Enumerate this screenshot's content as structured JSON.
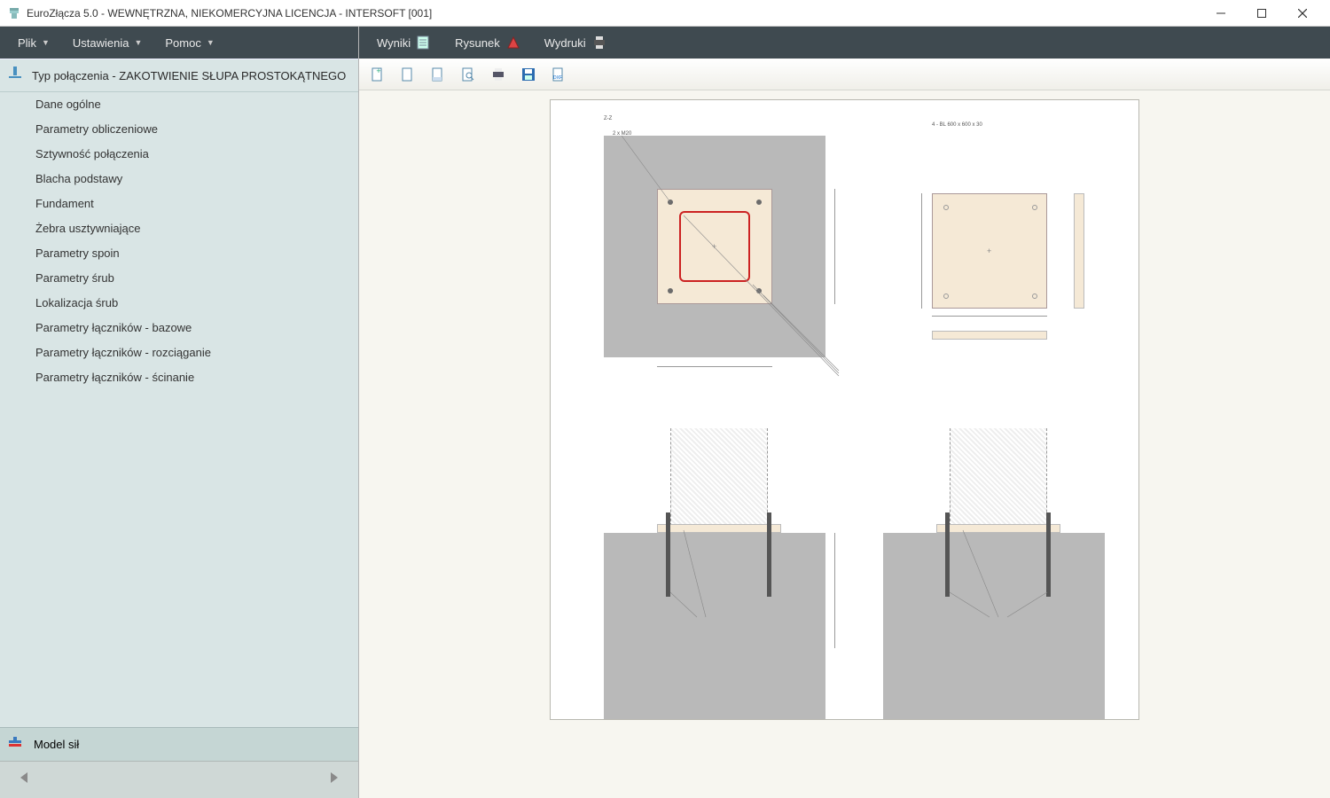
{
  "window": {
    "title": "EuroZłącza 5.0 - WEWNĘTRZNA, NIEKOMERCYJNA LICENCJA - INTERSOFT [001]"
  },
  "left_menubar": {
    "items": [
      {
        "label": "Plik",
        "has_dropdown": true
      },
      {
        "label": "Ustawienia",
        "has_dropdown": true
      },
      {
        "label": "Pomoc",
        "has_dropdown": true
      }
    ]
  },
  "right_menubar": {
    "items": [
      {
        "label": "Wyniki",
        "icon": "results-icon"
      },
      {
        "label": "Rysunek",
        "icon": "drawing-icon"
      },
      {
        "label": "Wydruki",
        "icon": "print-icon"
      }
    ]
  },
  "sidebar": {
    "header": "Typ połączenia - ZAKOTWIENIE SŁUPA PROSTOKĄTNEGO",
    "items": [
      "Dane ogólne",
      "Parametry obliczeniowe",
      "Sztywność połączenia",
      "Blacha podstawy",
      "Fundament",
      "Żebra usztywniające",
      "Parametry spoin",
      "Parametry śrub",
      "Lokalizacja śrub",
      "Parametry łączników - bazowe",
      "Parametry łączników - rozciąganie",
      "Parametry łączników - ścinanie"
    ],
    "footer": "Model sił"
  },
  "right_toolbar": {
    "icons": [
      "new-page-icon",
      "page-icon",
      "page-settings-icon",
      "zoom-page-icon",
      "print-icon",
      "save-icon",
      "dxf-export-icon"
    ]
  },
  "drawing": {
    "labels": {
      "top_left_view": "Z-Z",
      "top_right_note": "4 - BL 600 x 600 x 30",
      "annot1": "2 x M20"
    }
  }
}
